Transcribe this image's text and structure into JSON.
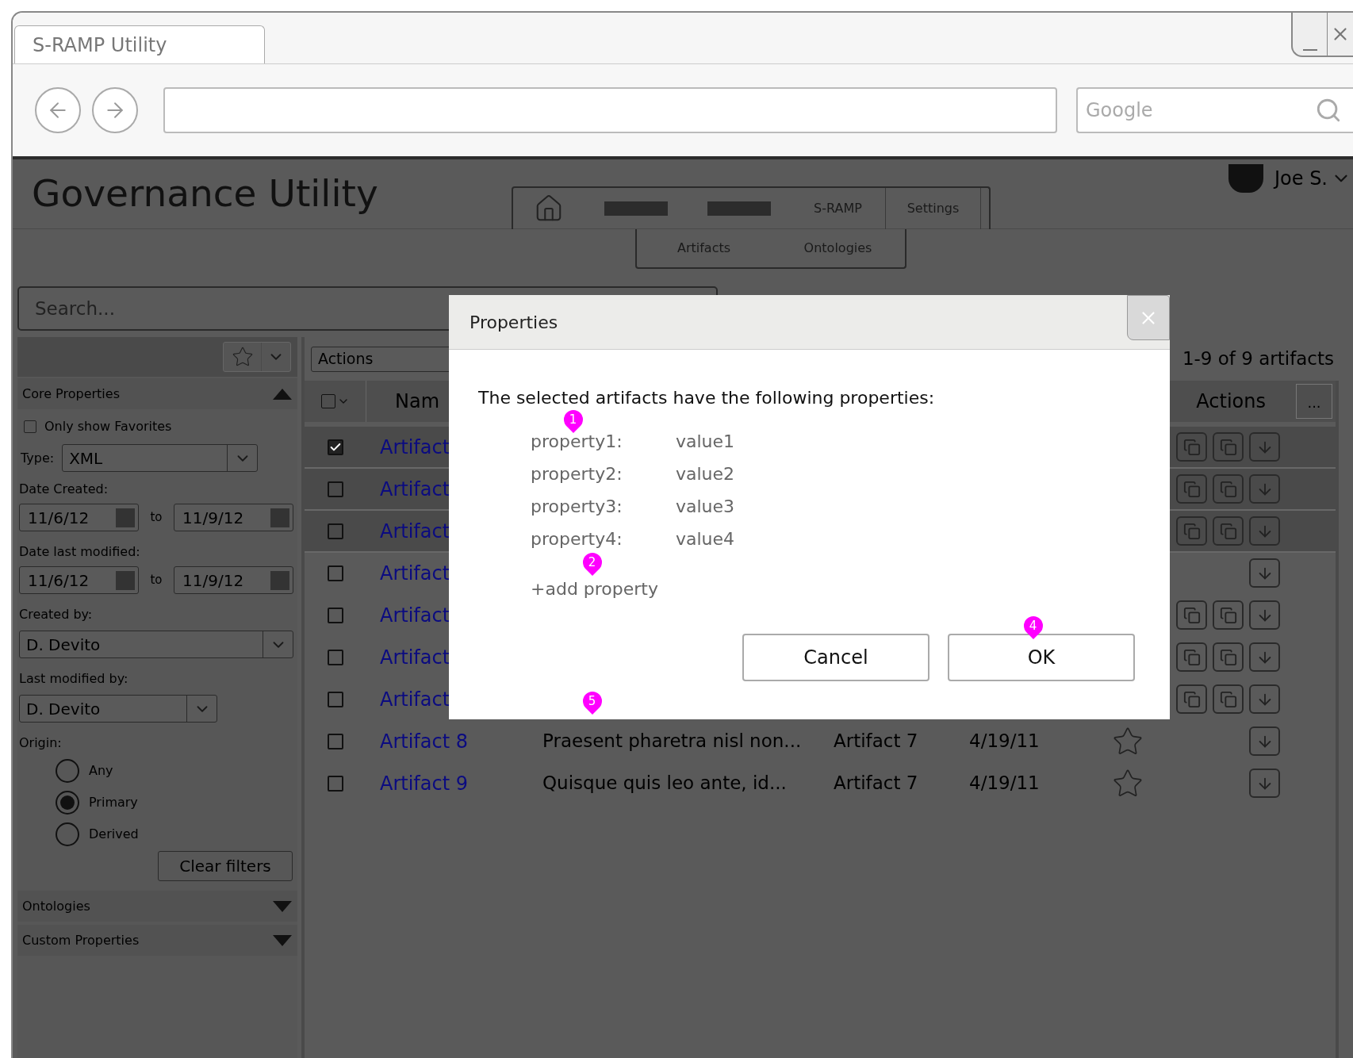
{
  "browser": {
    "tab_title": "S-RAMP Utility",
    "search_placeholder": "Google"
  },
  "app": {
    "title": "Governance Utility",
    "user": "Joe S.",
    "nav": [
      {
        "kind": "home"
      },
      {
        "kind": "blank"
      },
      {
        "kind": "blank"
      },
      {
        "kind": "text",
        "label": "S-RAMP"
      },
      {
        "kind": "text",
        "label": "Settings"
      }
    ],
    "subnav": [
      "Artifacts",
      "Ontologies"
    ],
    "search": {
      "placeholder": "Search..."
    }
  },
  "sidebar": {
    "sections": [
      {
        "title": "Core Properties",
        "expanded": true
      },
      {
        "title": "Ontologies",
        "expanded": false
      },
      {
        "title": "Custom Properties",
        "expanded": false
      }
    ],
    "favorites": {
      "label": "Only show Favorites",
      "checked": false
    },
    "type": {
      "label": "Type:",
      "value": "XML"
    },
    "date_created": {
      "label": "Date Created:",
      "from": "11/6/12",
      "to_label": "to",
      "to": "11/9/12"
    },
    "date_modified": {
      "label": "Date last modified:",
      "from": "11/6/12",
      "to_label": "to",
      "to": "11/9/12"
    },
    "created_by": {
      "label": "Created by:",
      "value": "D. Devito"
    },
    "modified_by": {
      "label": "Last modified by:",
      "value": "D. Devito"
    },
    "origin": {
      "label": "Origin:",
      "options": [
        {
          "label": "Any",
          "selected": false
        },
        {
          "label": "Primary",
          "selected": true
        },
        {
          "label": "Derived",
          "selected": false
        }
      ]
    },
    "clear_button": "Clear filters"
  },
  "toolbar": {
    "actions": "Actions",
    "count": "1-9 of 9 artifacts"
  },
  "table": {
    "columns": [
      "Nam",
      "Actions"
    ],
    "more": "...",
    "select_all": {
      "checked": false
    },
    "rows": [
      {
        "name": "Artifact",
        "checked": true,
        "highlighted": true,
        "copy_actions": true
      },
      {
        "name": "Artifact",
        "checked": false,
        "highlighted": true,
        "copy_actions": true
      },
      {
        "name": "Artifact",
        "checked": false,
        "highlighted": true,
        "copy_actions": true
      },
      {
        "name": "Artifact",
        "checked": false,
        "highlighted": false,
        "copy_actions": false
      },
      {
        "name": "Artifact",
        "checked": false,
        "highlighted": false,
        "copy_actions": true
      },
      {
        "name": "Artifact",
        "checked": false,
        "highlighted": false,
        "copy_actions": true
      },
      {
        "name": "Artifact",
        "checked": false,
        "highlighted": false,
        "copy_actions": true
      },
      {
        "name": "Artifact 8",
        "description": "Praesent pharetra nisl non...",
        "column_3": "Artifact 7",
        "date": "4/19/11",
        "checked": false,
        "highlighted": false,
        "copy_actions": false,
        "favorite": false
      },
      {
        "name": "Artifact 9",
        "description": "Quisque quis leo ante, id...",
        "column_3": "Artifact 7",
        "date": "4/19/11",
        "checked": false,
        "highlighted": false,
        "copy_actions": false,
        "favorite": false
      }
    ]
  },
  "dialog": {
    "title": "Properties",
    "message": "The selected artifacts have the following properties:",
    "properties": [
      {
        "name": "property1:",
        "value": "value1"
      },
      {
        "name": "property2:",
        "value": "value2"
      },
      {
        "name": "property3:",
        "value": "value3"
      },
      {
        "name": "property4:",
        "value": "value4"
      }
    ],
    "add_link": "+add property",
    "buttons": [
      "Cancel",
      "OK"
    ]
  },
  "annotations": [
    "1",
    "2",
    "4",
    "5"
  ]
}
